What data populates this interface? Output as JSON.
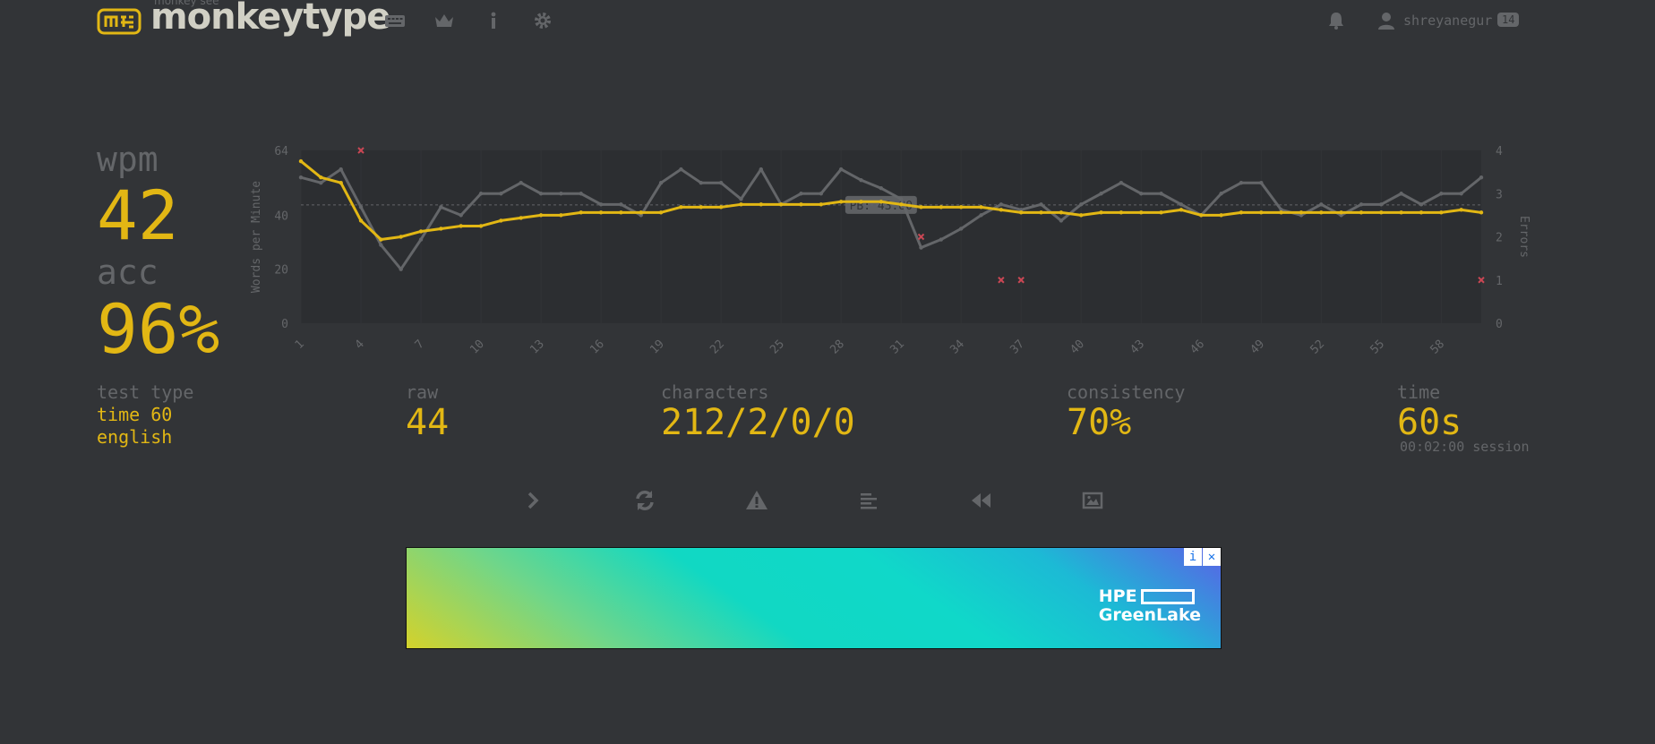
{
  "header": {
    "logo_small": "monkey see",
    "logo_text": "monkeytype",
    "nav": [
      "keyboard-icon",
      "crown-icon",
      "info-icon",
      "gear-icon"
    ],
    "username": "shreyanegur",
    "level": "14"
  },
  "stats": {
    "wpm_label": "wpm",
    "wpm_value": "42",
    "acc_label": "acc",
    "acc_value": "96%",
    "test_type_label": "test type",
    "test_type_line1": "time 60",
    "test_type_line2": "english",
    "raw_label": "raw",
    "raw_value": "44",
    "characters_label": "characters",
    "characters_value": "212/2/0/0",
    "consistency_label": "consistency",
    "consistency_value": "70%",
    "time_label": "time",
    "time_value": "60s",
    "session": "00:02:00 session"
  },
  "chart_data": {
    "type": "line",
    "ylabel": "Words per Minute",
    "y2label": "Errors",
    "ylim": [
      0,
      64
    ],
    "y2lim": [
      0,
      4
    ],
    "yticks": [
      0,
      20,
      40,
      64
    ],
    "y2ticks": [
      0,
      1,
      2,
      3,
      4
    ],
    "x": [
      1,
      2,
      3,
      4,
      5,
      6,
      7,
      8,
      9,
      10,
      11,
      12,
      13,
      14,
      15,
      16,
      17,
      18,
      19,
      20,
      21,
      22,
      23,
      24,
      25,
      26,
      27,
      28,
      29,
      30,
      31,
      32,
      33,
      34,
      35,
      36,
      37,
      38,
      39,
      40,
      41,
      42,
      43,
      44,
      45,
      46,
      47,
      48,
      49,
      50,
      51,
      52,
      53,
      54,
      55,
      56,
      57,
      58,
      59,
      60
    ],
    "xticks": [
      1,
      4,
      7,
      10,
      13,
      16,
      19,
      22,
      25,
      28,
      31,
      34,
      37,
      40,
      43,
      46,
      49,
      52,
      55,
      58
    ],
    "pb_label": "PB: 43.80",
    "pb_value": 43.8,
    "colors": {
      "wpm": "#e2b714",
      "raw": "#646669",
      "errors": "#ca4754"
    },
    "series": [
      {
        "name": "wpm",
        "values": [
          60,
          54,
          52,
          38,
          31,
          32,
          34,
          35,
          36,
          36,
          38,
          39,
          40,
          40,
          41,
          41,
          41,
          41,
          41,
          43,
          43,
          43,
          44,
          44,
          44,
          44,
          44,
          45,
          45,
          45,
          44,
          43,
          43,
          43,
          43,
          42,
          41,
          41,
          41,
          40,
          41,
          41,
          41,
          41,
          42,
          40,
          40,
          41,
          41,
          41,
          41,
          41,
          41,
          41,
          41,
          41,
          41,
          41,
          42,
          41
        ]
      },
      {
        "name": "raw",
        "values": [
          54,
          52,
          57,
          43,
          29,
          20,
          31,
          43,
          40,
          48,
          48,
          52,
          48,
          48,
          48,
          44,
          44,
          40,
          52,
          57,
          52,
          52,
          46,
          57,
          44,
          48,
          48,
          57,
          53,
          50,
          46,
          28,
          31,
          35,
          40,
          44,
          42,
          44,
          38,
          44,
          48,
          52,
          48,
          48,
          44,
          40,
          48,
          52,
          52,
          42,
          40,
          44,
          40,
          44,
          44,
          48,
          44,
          48,
          48,
          54
        ]
      },
      {
        "name": "errors",
        "points": [
          [
            4,
            4
          ],
          [
            32,
            2
          ],
          [
            36,
            1
          ],
          [
            37,
            1
          ],
          [
            60,
            1
          ]
        ]
      }
    ]
  },
  "actions": [
    "next-test-icon",
    "restart-icon",
    "warning-icon",
    "words-history-icon",
    "replay-icon",
    "screenshot-icon"
  ],
  "ad": {
    "brand_line1": "HPE",
    "brand_line2": "GreenLake",
    "info": "i",
    "close": "✕"
  }
}
